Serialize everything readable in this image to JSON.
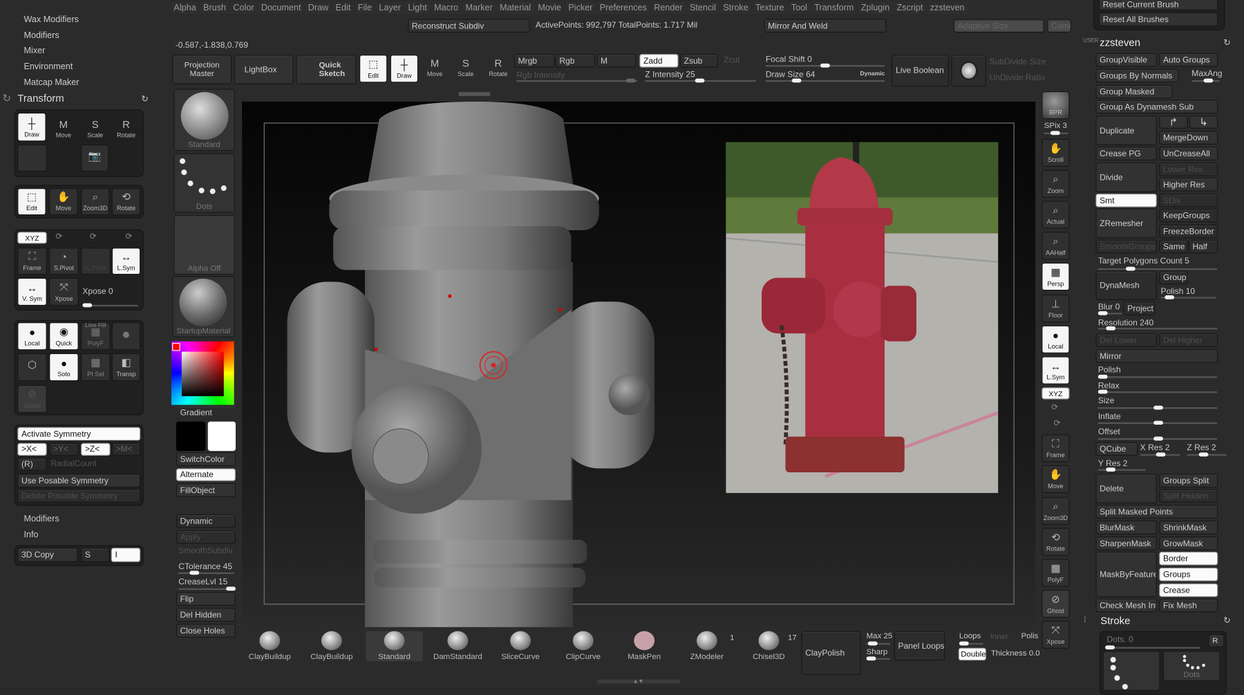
{
  "menu": [
    "Alpha",
    "Brush",
    "Color",
    "Document",
    "Draw",
    "Edit",
    "File",
    "Layer",
    "Light",
    "Macro",
    "Marker",
    "Material",
    "Movie",
    "Picker",
    "Preferences",
    "Render",
    "Stencil",
    "Stroke",
    "Texture",
    "Tool",
    "Transform",
    "Zplugin",
    "Zscript",
    "zzsteven"
  ],
  "top": {
    "reconstruct": "Reconstruct Subdiv",
    "points": "ActivePoints: 992,797 TotalPoints: 1.717 Mil",
    "mirror_weld": "Mirror And Weld",
    "adaptive": "Adaptive Size",
    "comb": "Comb",
    "coords": "-0.587,-1.838,0.769"
  },
  "toolbar": {
    "projection_master": "Projection Master",
    "lightbox": "LightBox",
    "quick_sketch": "Quick Sketch",
    "edit": "Edit",
    "draw": "Draw",
    "move": "Move",
    "scale": "Scale",
    "rotate": "Rotate",
    "mrgb": "Mrgb",
    "rgb": "Rgb",
    "m": "M",
    "zadd": "Zadd",
    "zsub": "Zsub",
    "zcut": "Zcut",
    "rgb_intensity": "Rgb Intensity",
    "z_intensity": "Z Intensity 25",
    "focal_shift": "Focal Shift 0",
    "draw_size": "Draw Size 64",
    "dynamic": "Dynamic",
    "live_boolean": "Live Boolean",
    "subdivide_size": "SubDivide Size",
    "undivide_ratio": "UnDivide Ratio",
    "z_intensity_value": 25,
    "focal_shift_value": 0,
    "draw_size_value": 64
  },
  "left": {
    "menu": [
      "Wax Modifiers",
      "Modifiers",
      "Mixer",
      "Environment",
      "Matcap Maker"
    ],
    "transform_title": "Transform",
    "row1": [
      "Draw",
      "Move",
      "Scale",
      "Rotate"
    ],
    "row2": [
      "Edit",
      "Move",
      "Zoom3D",
      "Rotate"
    ],
    "xyz": "XYZ",
    "frame": "Frame",
    "spivot": "S.Pivot",
    "cpivot": "C.Pivot",
    "lsym": "L.Sym",
    "vsym": "V. Sym",
    "xpose": "Xpose",
    "xpose_val": "Xpose 0",
    "local": "Local",
    "quick": "Quick",
    "linefill": "Line Fill",
    "polyf": "PolyF",
    "solo": "Solo",
    "ptsel": "Pt Sel",
    "transp": "Transp",
    "ghost": "Ghost",
    "activate_sym": "Activate Symmetry",
    "sx": ">X<",
    "sy": ">Y<",
    "sz": ">Z<",
    "sm": ">M<",
    "r": "(R)",
    "radial": "RadialCount",
    "use_posable": "Use Posable Symmetry",
    "del_posable": "Delete Posable Symmetry",
    "modifiers": "Modifiers",
    "info": "Info",
    "copy3d": "3D Copy",
    "s": "S",
    "i": "I"
  },
  "col2": {
    "standard": "Standard",
    "dots": "Dots",
    "alpha_off": "Alpha Off",
    "material": "StartupMaterial",
    "gradient": "Gradient",
    "switch_color": "SwitchColor",
    "alternate": "Alternate",
    "fill_object": "FillObject",
    "dynamic": "Dynamic",
    "apply": "Apply",
    "smooth_subdiv": "SmoothSubdiv",
    "ctolerance": "CTolerance 45",
    "creaselvl": "CreaseLvl 15",
    "flip": "Flip",
    "del_hidden": "Del Hidden",
    "close_holes": "Close Holes",
    "main_color": "#ff0000"
  },
  "shelf": {
    "bpr": "BPR",
    "spix": "SPix 3",
    "items": [
      "Scroll",
      "Zoom",
      "Actual",
      "AAHalf",
      "Persp",
      "Floor",
      "Local",
      "L.Sym"
    ],
    "xyz": "XYZ",
    "items2": [
      "Frame",
      "Move",
      "Zoom3D",
      "Rotate",
      "PolyF",
      "Ghost",
      "Xpose"
    ],
    "linefill": "Line Fill"
  },
  "bottom": {
    "brushes": [
      "ClayBuildup",
      "ClayBuildup",
      "Standard",
      "DamStandard",
      "SliceCurve",
      "ClipCurve",
      "MaskPen",
      "ZModeler",
      "Chisel3D"
    ],
    "zmodeler_count": "1",
    "chisel_count": "17",
    "claypolish": "ClayPolish",
    "max": "Max 25",
    "sharp": "Sharp",
    "panel_loops": "Panel Loops",
    "loops": "Loops",
    "inner": "Inner",
    "polish": "Polis",
    "double": "Double",
    "thickness": "Thickness 0.0"
  },
  "right": {
    "reset_current": "Reset Current Brush",
    "reset_all": "Reset All Brushes",
    "user_label": "USER",
    "user": "zzsteven",
    "group_visible": "GroupVisible",
    "auto_groups": "Auto Groups",
    "groups_by_normals": "Groups By Normals",
    "maxang": "MaxAng",
    "group_masked": "Group Masked",
    "group_dynamesh": "Group As Dynamesh Sub",
    "duplicate": "Duplicate",
    "merge_down": "MergeDown",
    "crease_pg": "Crease PG",
    "uncrease_all": "UnCreaseAll",
    "divide": "Divide",
    "lower_res": "Lower Res",
    "higher_res": "Higher Res",
    "smt": "Smt",
    "sdiv": "SDiv",
    "zremesher": "ZRemesher",
    "keep_groups": "KeepGroups",
    "freeze_border": "FreezeBorder",
    "smooth_groups": "SmoothGroups",
    "same": "Same",
    "half": "Half",
    "target_polys": "Target Polygons Count 5",
    "dynamesh": "DynaMesh",
    "groups": "Groups",
    "polish10": "Polish 10",
    "blur": "Blur 0",
    "project": "Project",
    "resolution": "Resolution 240",
    "del_lower": "Del Lower",
    "del_higher": "Del Higher",
    "mirror": "Mirror",
    "polish": "Polish",
    "relax": "Relax",
    "size": "Size",
    "inflate": "Inflate",
    "offset": "Offset",
    "qcube": "QCube",
    "xres": "X Res 2",
    "zres": "Z Res 2",
    "yres": "Y Res 2",
    "delete": "Delete",
    "groups_split": "Groups Split",
    "split_hidden": "Split Hidden",
    "split_masked": "Split Masked Points",
    "blur_mask": "BlurMask",
    "shrink_mask": "ShrinkMask",
    "sharpen_mask": "SharpenMask",
    "grow_mask": "GrowMask",
    "mask_by_feature": "MaskByFeature",
    "border": "Border",
    "groups2": "Groups",
    "crease": "Crease",
    "check_mesh": "Check Mesh Int",
    "fix_mesh": "Fix Mesh",
    "stroke": "Stroke",
    "dots": "Dots. 0",
    "r": "R",
    "dots_label": "Dots"
  }
}
